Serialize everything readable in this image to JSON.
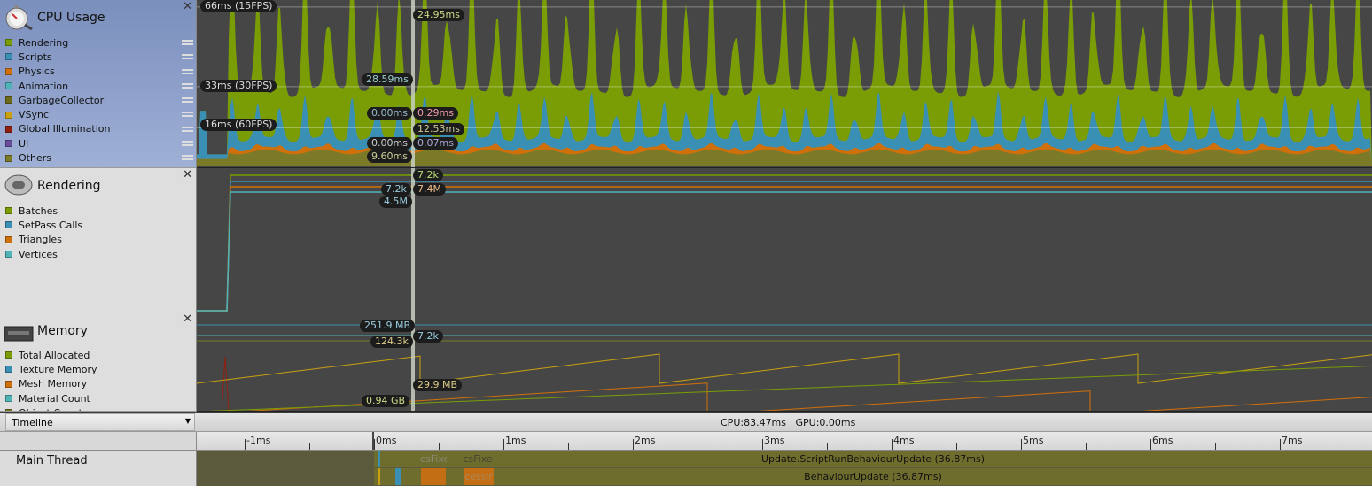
{
  "cpu": {
    "title": "CPU Usage",
    "icon": "stopwatch-icon",
    "legend": [
      {
        "label": "Rendering",
        "color": "#7a9d05"
      },
      {
        "label": "Scripts",
        "color": "#3a8fb5"
      },
      {
        "label": "Physics",
        "color": "#d0700a"
      },
      {
        "label": "Animation",
        "color": "#4fb3b8"
      },
      {
        "label": "GarbageCollector",
        "color": "#6b6b1a"
      },
      {
        "label": "VSync",
        "color": "#c9a010"
      },
      {
        "label": "Global Illumination",
        "color": "#8f2010"
      },
      {
        "label": "UI",
        "color": "#6a4c9c"
      },
      {
        "label": "Others",
        "color": "#7a7a28"
      }
    ],
    "guides": [
      "66ms (15FPS)",
      "33ms (30FPS)",
      "16ms (60FPS)"
    ],
    "selection_left": [
      "28.59ms",
      "0.00ms",
      "0.00ms",
      "9.60ms"
    ],
    "selection_right": [
      "24.95ms",
      "0.29ms",
      "12.53ms",
      "0.07ms"
    ]
  },
  "rendering": {
    "title": "Rendering",
    "icon": "rendering-icon",
    "legend": [
      {
        "label": "Batches",
        "color": "#7a9d05"
      },
      {
        "label": "SetPass Calls",
        "color": "#3a8fb5"
      },
      {
        "label": "Triangles",
        "color": "#d0700a"
      },
      {
        "label": "Vertices",
        "color": "#4fb3b8"
      }
    ],
    "labels_left": [
      "7.2k",
      "4.5M"
    ],
    "labels_right": [
      "7.2k",
      "7.4M"
    ]
  },
  "memory": {
    "title": "Memory",
    "icon": "memory-chip-icon",
    "legend": [
      {
        "label": "Total Allocated",
        "color": "#7a9d05"
      },
      {
        "label": "Texture Memory",
        "color": "#3a8fb5"
      },
      {
        "label": "Mesh Memory",
        "color": "#d0700a"
      },
      {
        "label": "Material Count",
        "color": "#4fb3b8"
      },
      {
        "label": "Object Count",
        "color": "#7a7a28"
      }
    ],
    "labels_left": [
      "251.9 MB",
      "124.3k",
      "0.94 GB"
    ],
    "labels_right": [
      "7.2k",
      "29.9 MB"
    ]
  },
  "toolbar": {
    "view": "Timeline",
    "cpu": "CPU:83.47ms",
    "gpu": "GPU:0.00ms"
  },
  "ruler": [
    "-1ms",
    "0ms",
    "1ms",
    "2ms",
    "3ms",
    "4ms",
    "5ms",
    "6ms",
    "7ms"
  ],
  "thread": {
    "name": "Main Thread",
    "row1": "Update.ScriptRunBehaviourUpdate (36.87ms)",
    "row2": "BehaviourUpdate (36.87ms)",
    "small1": "csFixe",
    "small2": "cessir"
  }
}
